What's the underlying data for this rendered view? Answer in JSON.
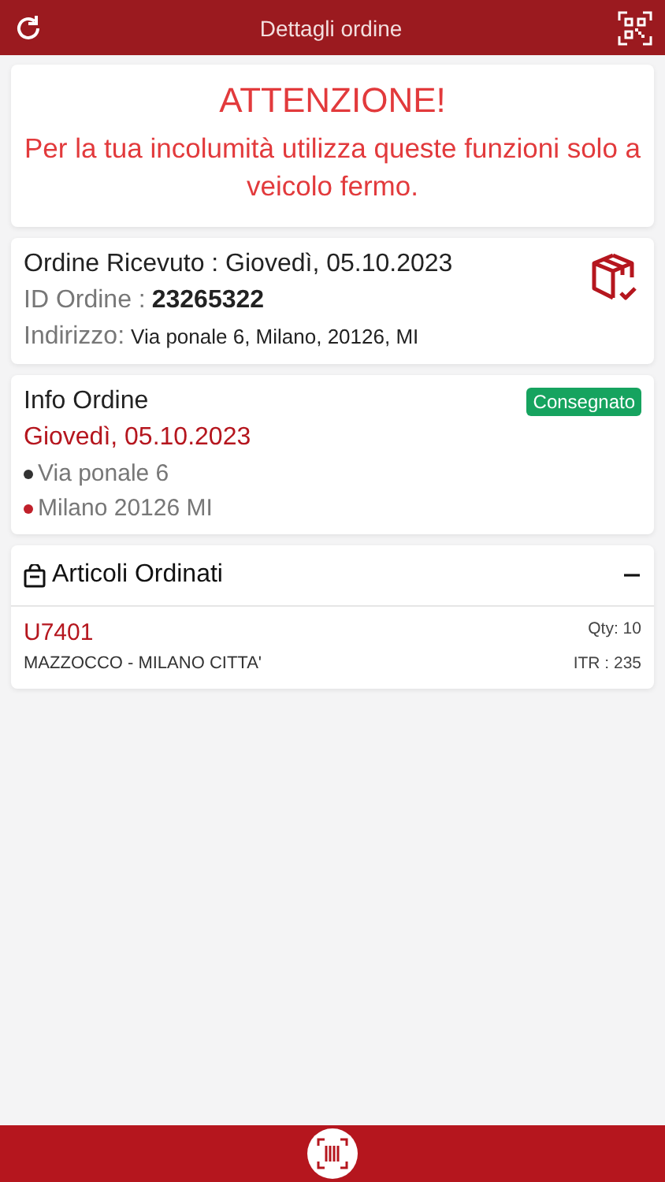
{
  "header": {
    "title": "Dettagli ordine"
  },
  "warning": {
    "title": "ATTENZIONE!",
    "message": "Per la tua incolumità utilizza queste funzioni solo a veicolo fermo."
  },
  "order_summary": {
    "received_label": "Ordine Ricevuto : Giovedì, 05.10.2023",
    "id_label": "ID Ordine :",
    "id_value": "23265322",
    "address_label": "Indirizzo:",
    "address_value": "Via ponale 6, Milano, 20126, MI"
  },
  "order_info": {
    "title": "Info Ordine",
    "status": "Consegnato",
    "date": "Giovedì, 05.10.2023",
    "stops": [
      {
        "text": "Via ponale 6",
        "color": "#333333"
      },
      {
        "text": "Milano 20126 MI",
        "color": "#c0202a"
      }
    ]
  },
  "ordered_items": {
    "title": "Articoli Ordinati",
    "expanded": true,
    "items": [
      {
        "code": "U7401",
        "description": "MAZZOCCO - MILANO CITTA'",
        "qty": "Qty: 10",
        "itr": "ITR : 235"
      }
    ]
  }
}
